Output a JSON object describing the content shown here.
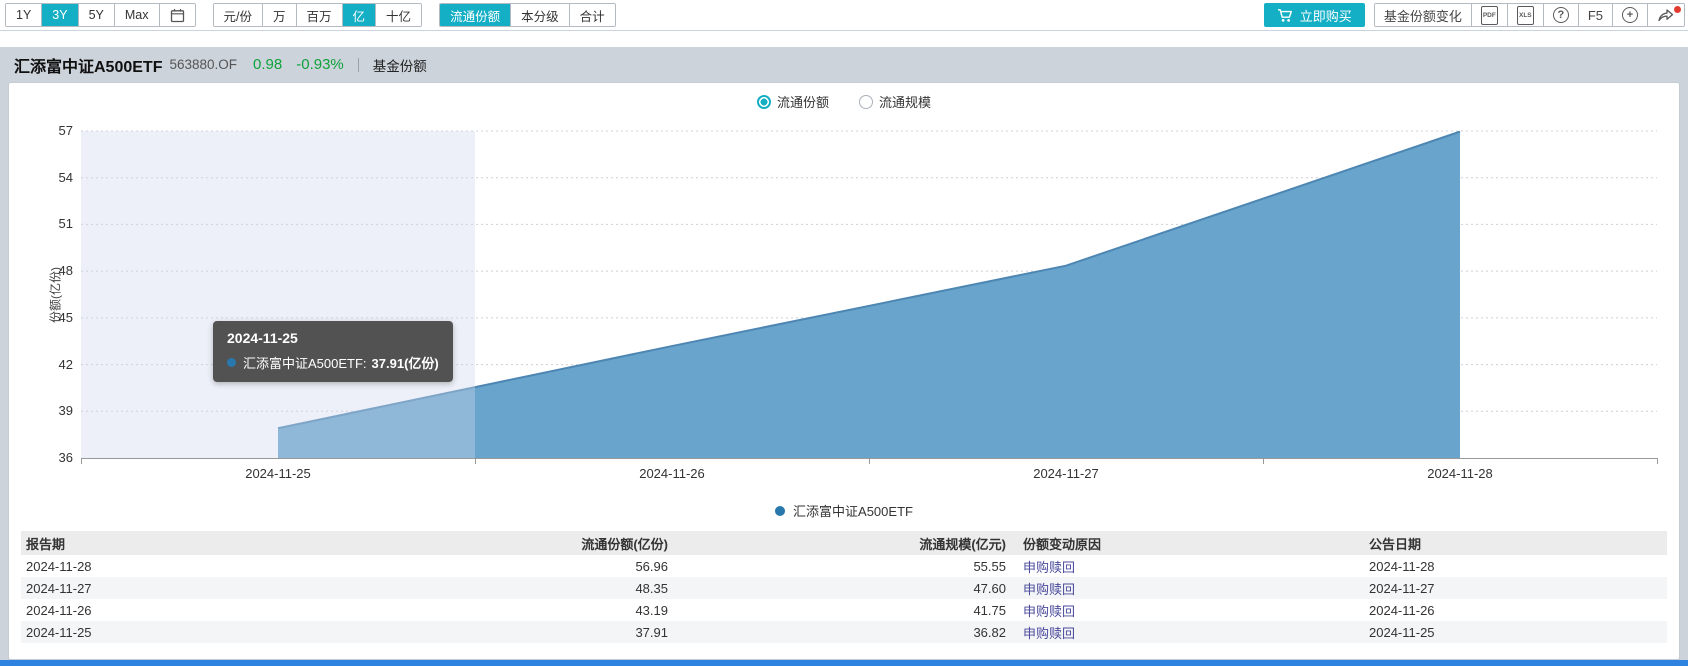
{
  "toolbar": {
    "range_buttons": [
      {
        "label": "1Y",
        "active": false
      },
      {
        "label": "3Y",
        "active": true
      },
      {
        "label": "5Y",
        "active": false
      },
      {
        "label": "Max",
        "active": false
      }
    ],
    "unit_buttons": [
      {
        "label": "元/份",
        "active": false
      },
      {
        "label": "万",
        "active": false
      },
      {
        "label": "百万",
        "active": false
      },
      {
        "label": "亿",
        "active": true
      },
      {
        "label": "十亿",
        "active": false
      }
    ],
    "mode_buttons": [
      {
        "label": "流通份额",
        "active": true
      },
      {
        "label": "本分级",
        "active": false
      },
      {
        "label": "合计",
        "active": false
      }
    ],
    "buy_button": "立即购买",
    "share_change_button": "基金份额变化",
    "pdf_label": "PDF",
    "xls_label": "XLS",
    "help_label": "?",
    "f5_label": "F5",
    "plus_label": "+"
  },
  "header": {
    "fund_name": "汇添富中证A500ETF",
    "fund_code": "563880.OF",
    "price": "0.98",
    "change_pct": "-0.93%",
    "page_label": "基金份额"
  },
  "chart_data": {
    "type": "area",
    "radio_options": [
      {
        "label": "流通份额",
        "selected": true
      },
      {
        "label": "流通规模",
        "selected": false
      }
    ],
    "ylabel": "份额(亿份)",
    "ylim": [
      36,
      57
    ],
    "yticks": [
      57,
      54,
      51,
      48,
      45,
      42,
      39,
      36
    ],
    "categories": [
      "2024-11-25",
      "2024-11-26",
      "2024-11-27",
      "2024-11-28"
    ],
    "series": [
      {
        "name": "汇添富中证A500ETF",
        "values": [
          37.91,
          43.19,
          48.35,
          56.96
        ]
      }
    ],
    "highlight_category_index": 0,
    "tooltip": {
      "date": "2024-11-25",
      "series_label": "汇添富中证A500ETF:",
      "value_text": "37.91(亿份)"
    },
    "legend": [
      "汇添富中证A500ETF"
    ],
    "grid": true,
    "legend_position": "bottom-center",
    "colors": {
      "area_fill": "#68a4cb",
      "area_line": "#4d86b2",
      "dot": "#2878ad",
      "highlight_band": "rgba(208,215,236,0.38)",
      "gridline": "#ccd0d6",
      "axis": "#999999"
    }
  },
  "table": {
    "columns": [
      {
        "label": "报告期",
        "align": "left"
      },
      {
        "label": "流通份额(亿份)",
        "align": "right"
      },
      {
        "label": "流通规模(亿元)",
        "align": "right"
      },
      {
        "label": "份额变动原因",
        "align": "left"
      },
      {
        "label": "公告日期",
        "align": "left"
      }
    ],
    "rows": [
      [
        "2024-11-28",
        "56.96",
        "55.55",
        "申购赎回",
        "2024-11-28"
      ],
      [
        "2024-11-27",
        "48.35",
        "47.60",
        "申购赎回",
        "2024-11-27"
      ],
      [
        "2024-11-26",
        "43.19",
        "41.75",
        "申购赎回",
        "2024-11-26"
      ],
      [
        "2024-11-25",
        "37.91",
        "36.82",
        "申购赎回",
        "2024-11-25"
      ]
    ]
  },
  "colors": {
    "accent": "#15afc5",
    "green": "#0fa23c",
    "link": "#4a4a9c",
    "bottombar": "#2e82e0",
    "strip": "#ccd3da"
  }
}
